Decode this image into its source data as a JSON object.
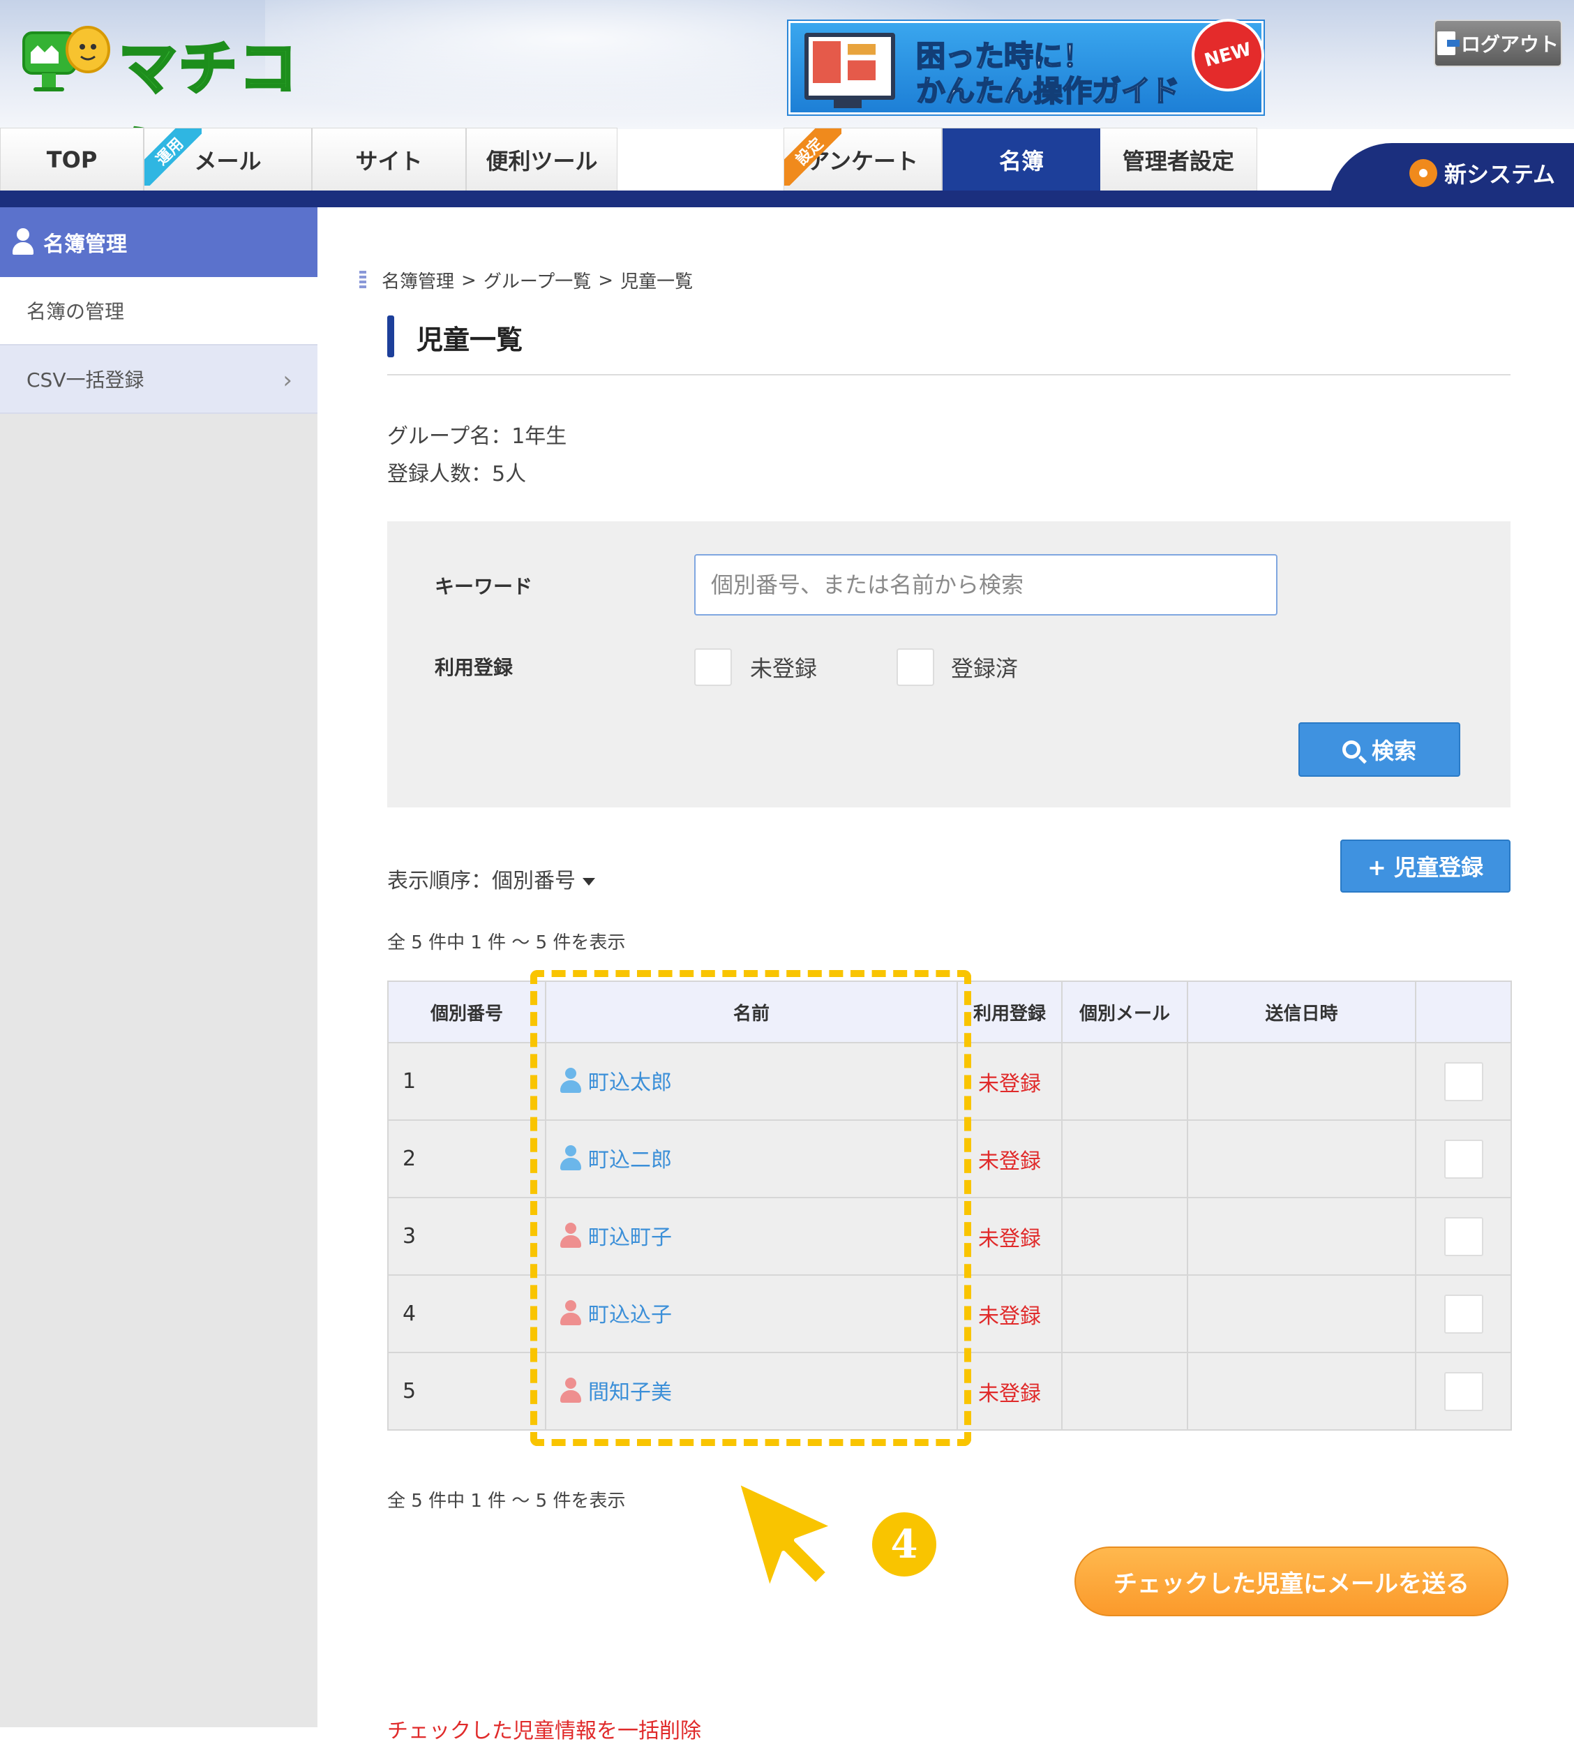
{
  "header": {
    "logo_text": "マチコミ",
    "guide_banner": {
      "line1": "困った時に！",
      "line2": "かんたん操作ガイド",
      "badge": "NEW"
    },
    "logout_label": "ログアウト"
  },
  "nav": {
    "tabs_left": [
      {
        "label": "TOP",
        "ribbon": ""
      },
      {
        "label": "メール",
        "ribbon": "運用"
      },
      {
        "label": "サイト",
        "ribbon": ""
      },
      {
        "label": "便利ツール",
        "ribbon": ""
      }
    ],
    "tabs_right": [
      {
        "label": "アンケート",
        "ribbon": "設定"
      },
      {
        "label": "名簿",
        "ribbon": ""
      },
      {
        "label": "管理者設定",
        "ribbon": ""
      }
    ],
    "active_tab": "名簿",
    "new_system_label": "新システム"
  },
  "sidebar": {
    "heading": "名簿管理",
    "items": [
      {
        "label": "名簿の管理"
      },
      {
        "label": "CSV一括登録",
        "chevron": "›"
      }
    ]
  },
  "main": {
    "breadcrumb": [
      "名簿管理",
      "グループ一覧",
      "児童一覧"
    ],
    "breadcrumb_sep": ">",
    "title": "児童一覧",
    "group_name": "グループ名：1年生",
    "registered_count": "登録人数：5人",
    "search": {
      "keyword_label": "キーワード",
      "keyword_placeholder": "個別番号、または名前から検索",
      "keyword_value": "",
      "usage_label": "利用登録",
      "option_unregistered": "未登録",
      "option_registered": "登録済",
      "search_button": "検索"
    },
    "sort_label": "表示順序：個別番号",
    "add_button": "+ 児童登録",
    "count_text": "全 5 件中 1 件 ～ 5 件を表示",
    "table": {
      "headers": [
        "個別番号",
        "名前",
        "利用登録",
        "個別メール",
        "送信日時",
        ""
      ],
      "rows": [
        {
          "num": "1",
          "name": "町込太郎",
          "gender": "male",
          "status": "未登録",
          "mail": "",
          "sent": ""
        },
        {
          "num": "2",
          "name": "町込二郎",
          "gender": "male",
          "status": "未登録",
          "mail": "",
          "sent": ""
        },
        {
          "num": "3",
          "name": "町込町子",
          "gender": "female",
          "status": "未登録",
          "mail": "",
          "sent": ""
        },
        {
          "num": "4",
          "name": "町込込子",
          "gender": "female",
          "status": "未登録",
          "mail": "",
          "sent": ""
        },
        {
          "num": "5",
          "name": "間知子美",
          "gender": "female",
          "status": "未登録",
          "mail": "",
          "sent": ""
        }
      ]
    },
    "step_number": "4",
    "send_button": "チェックした児童にメールを送る",
    "delete_link": "チェックした児童情報を一括削除"
  },
  "colors": {
    "nav_dark": "#1b2f7e",
    "sidebar_head": "#5b72cc",
    "primary_button": "#3f92e0",
    "status_red": "#e02a2a",
    "link_blue": "#3b8fd8",
    "highlight_yellow": "#f9c400",
    "send_orange": "#fb9a2b"
  }
}
